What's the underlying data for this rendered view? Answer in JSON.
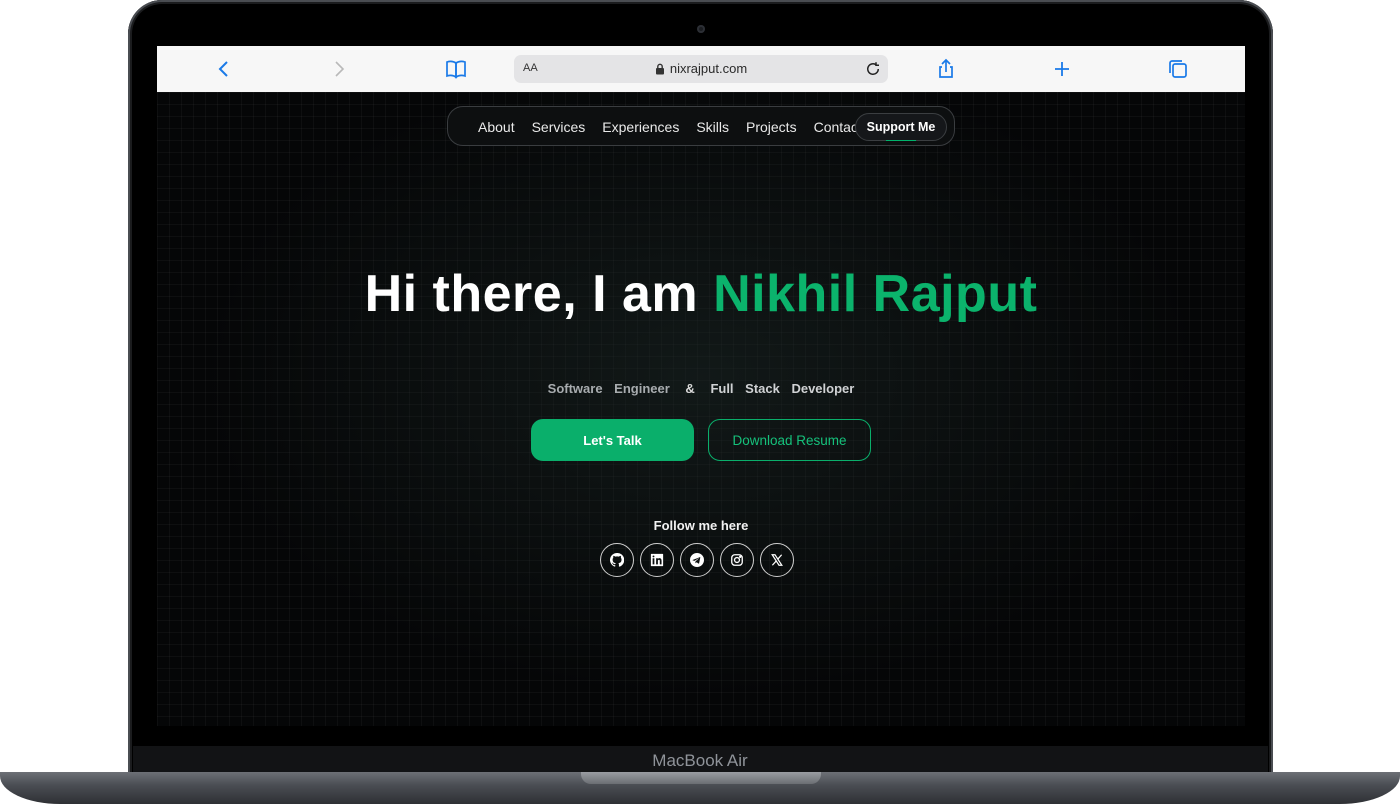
{
  "device": {
    "label": "MacBook Air"
  },
  "browser": {
    "text_size_label": "AA",
    "url": "nixrajput.com",
    "icons": [
      "back-icon",
      "forward-icon",
      "bookmarks-icon",
      "lock-icon",
      "reload-icon",
      "share-icon",
      "new-tab-icon",
      "tabs-icon"
    ]
  },
  "nav": {
    "links": [
      "About",
      "Services",
      "Experiences",
      "Skills",
      "Projects",
      "Contact"
    ],
    "support_label": "Support Me"
  },
  "hero": {
    "greeting": "Hi there, I am",
    "name": "Nikhil Rajput",
    "subtitle": {
      "part1": "Software Engineer",
      "amp": "&",
      "part2": "Full Stack Developer"
    },
    "primary_button": "Let's Talk",
    "secondary_button": "Download Resume",
    "follow_label": "Follow me here",
    "socials": [
      "github-icon",
      "linkedin-icon",
      "telegram-icon",
      "instagram-icon",
      "x-icon"
    ]
  },
  "colors": {
    "accent": "#0aaf6b",
    "background": "#050607",
    "safari_blue": "#1a7ae8"
  }
}
